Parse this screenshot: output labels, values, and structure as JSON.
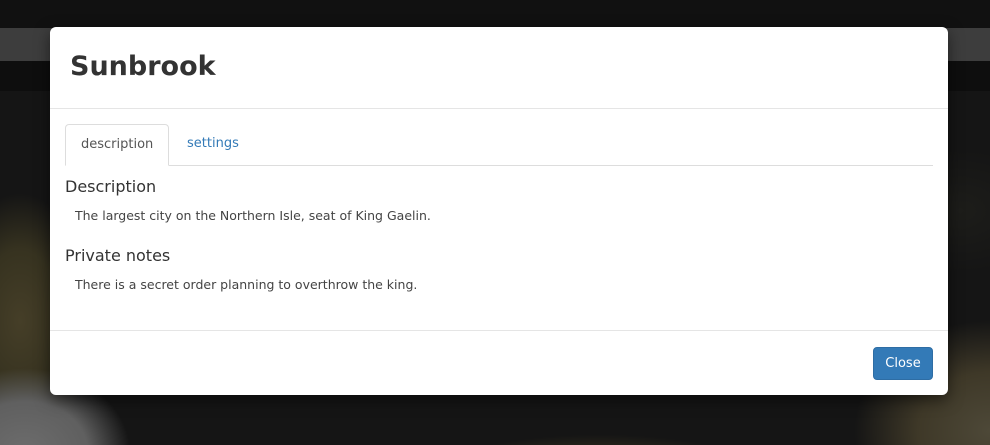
{
  "modal": {
    "title": "Sunbrook",
    "tabs": [
      {
        "label": "description",
        "active": true
      },
      {
        "label": "settings",
        "active": false
      }
    ],
    "sections": [
      {
        "heading": "Description",
        "text": "The largest city on the Northern Isle, seat of King Gaelin."
      },
      {
        "heading": "Private notes",
        "text": "There is a secret order planning to overthrow the king."
      }
    ],
    "footer": {
      "close_label": "Close"
    }
  },
  "colors": {
    "primary_button": "#337ab7",
    "link": "#337ab7",
    "overlay": "rgba(0,0,0,0.5)"
  }
}
